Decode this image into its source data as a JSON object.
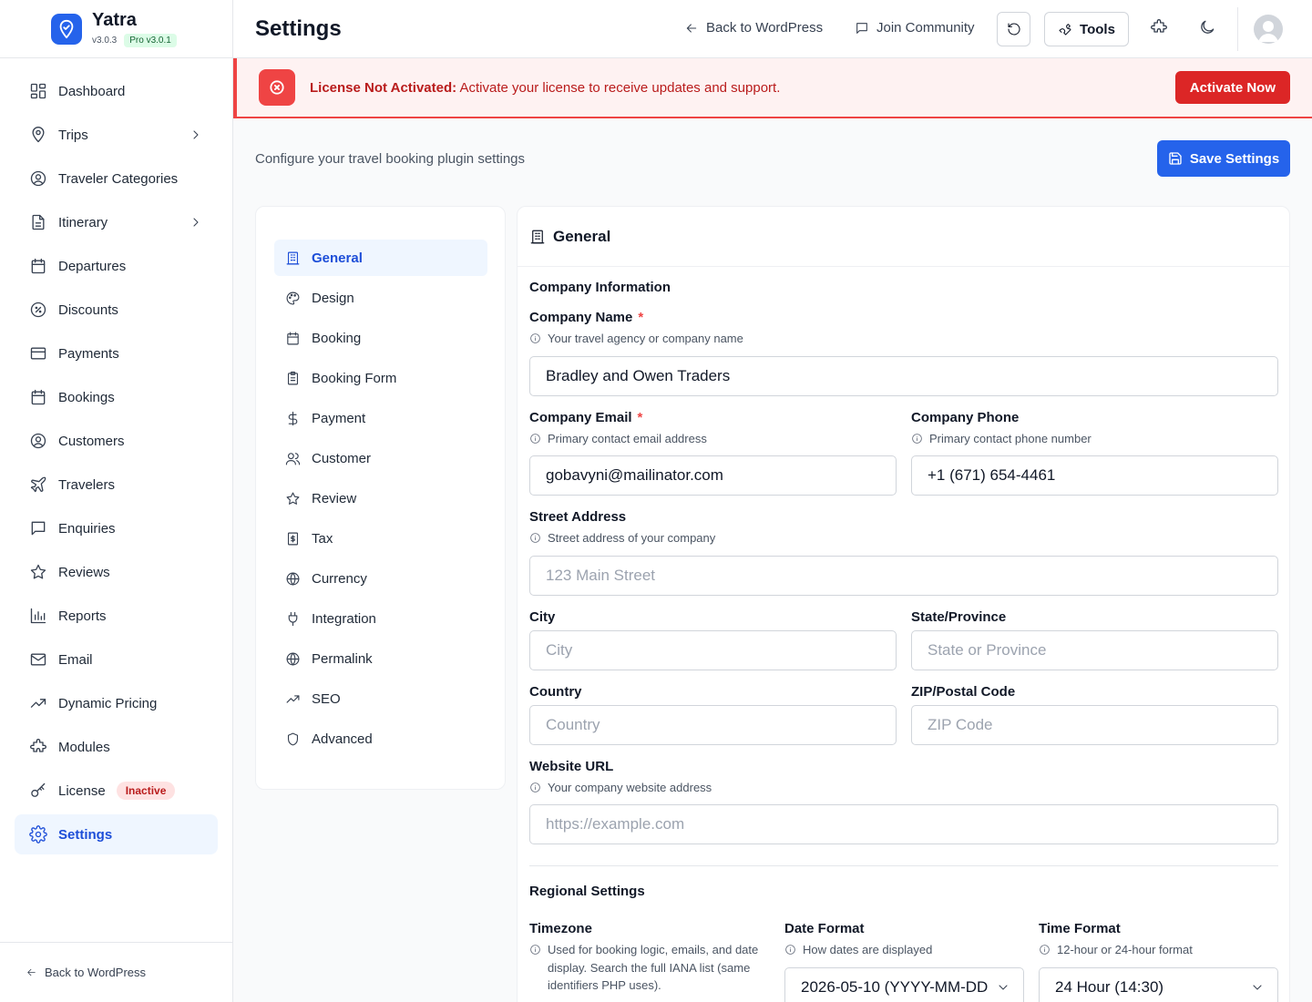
{
  "brand": {
    "name": "Yatra",
    "version": "v3.0.3",
    "pro": "Pro v3.0.1"
  },
  "sidebar": {
    "items": [
      {
        "label": "Dashboard",
        "icon": "dashboard-icon"
      },
      {
        "label": "Trips",
        "icon": "map-pin-icon",
        "has_children": true
      },
      {
        "label": "Traveler Categories",
        "icon": "user-circle-icon"
      },
      {
        "label": "Itinerary",
        "icon": "document-icon",
        "has_children": true
      },
      {
        "label": "Departures",
        "icon": "calendar-icon"
      },
      {
        "label": "Discounts",
        "icon": "discount-icon"
      },
      {
        "label": "Payments",
        "icon": "credit-card-icon"
      },
      {
        "label": "Bookings",
        "icon": "calendar-icon"
      },
      {
        "label": "Customers",
        "icon": "user-circle-icon"
      },
      {
        "label": "Travelers",
        "icon": "plane-icon"
      },
      {
        "label": "Enquiries",
        "icon": "message-icon"
      },
      {
        "label": "Reviews",
        "icon": "star-icon"
      },
      {
        "label": "Reports",
        "icon": "bar-chart-icon"
      },
      {
        "label": "Email",
        "icon": "mail-icon"
      },
      {
        "label": "Dynamic Pricing",
        "icon": "trending-up-icon"
      },
      {
        "label": "Modules",
        "icon": "puzzle-icon"
      },
      {
        "label": "License",
        "icon": "key-icon",
        "badge": "Inactive"
      },
      {
        "label": "Settings",
        "icon": "gear-icon",
        "active": true
      }
    ],
    "footer_link": "Back to WordPress"
  },
  "topbar": {
    "title": "Settings",
    "back_link": "Back to WordPress",
    "community_link": "Join Community",
    "tools_label": "Tools"
  },
  "alert": {
    "title": "License Not Activated:",
    "message": "Activate your license to receive updates and support.",
    "button": "Activate Now"
  },
  "page": {
    "subtitle": "Configure your travel booking plugin settings",
    "save_button": "Save Settings"
  },
  "settings_nav": [
    {
      "label": "General",
      "icon": "building-icon",
      "active": true
    },
    {
      "label": "Design",
      "icon": "palette-icon"
    },
    {
      "label": "Booking",
      "icon": "calendar-icon"
    },
    {
      "label": "Booking Form",
      "icon": "clipboard-icon"
    },
    {
      "label": "Payment",
      "icon": "dollar-icon"
    },
    {
      "label": "Customer",
      "icon": "users-icon"
    },
    {
      "label": "Review",
      "icon": "star-icon"
    },
    {
      "label": "Tax",
      "icon": "receipt-icon"
    },
    {
      "label": "Currency",
      "icon": "globe-icon"
    },
    {
      "label": "Integration",
      "icon": "plug-icon"
    },
    {
      "label": "Permalink",
      "icon": "globe-icon"
    },
    {
      "label": "SEO",
      "icon": "trending-up-icon"
    },
    {
      "label": "Advanced",
      "icon": "shield-icon"
    }
  ],
  "general": {
    "heading": "General",
    "company_section": "Company Information",
    "company_name": {
      "label": "Company Name",
      "required": "*",
      "help": "Your travel agency or company name",
      "value": "Bradley and Owen Traders"
    },
    "company_email": {
      "label": "Company Email",
      "required": "*",
      "help": "Primary contact email address",
      "value": "gobavyni@mailinator.com"
    },
    "company_phone": {
      "label": "Company Phone",
      "help": "Primary contact phone number",
      "value": "+1 (671) 654-4461"
    },
    "street": {
      "label": "Street Address",
      "help": "Street address of your company",
      "placeholder": "123 Main Street"
    },
    "city": {
      "label": "City",
      "placeholder": "City"
    },
    "state": {
      "label": "State/Province",
      "placeholder": "State or Province"
    },
    "country": {
      "label": "Country",
      "placeholder": "Country"
    },
    "zip": {
      "label": "ZIP/Postal Code",
      "placeholder": "ZIP Code"
    },
    "website": {
      "label": "Website URL",
      "help": "Your company website address",
      "placeholder": "https://example.com"
    },
    "regional_section": "Regional Settings",
    "timezone": {
      "label": "Timezone",
      "help": "Used for booking logic, emails, and date display. Search the full IANA list (same identifiers PHP uses)."
    },
    "date_format": {
      "label": "Date Format",
      "help": "How dates are displayed",
      "value": "2026-05-10 (YYYY-MM-DD"
    },
    "time_format": {
      "label": "Time Format",
      "help": "12-hour or 24-hour format",
      "value": "24 Hour (14:30)"
    }
  },
  "colors": {
    "primary": "#2563eb",
    "danger": "#dc2626",
    "alert_bg": "#fef2f2",
    "active_bg": "#eff6ff"
  }
}
